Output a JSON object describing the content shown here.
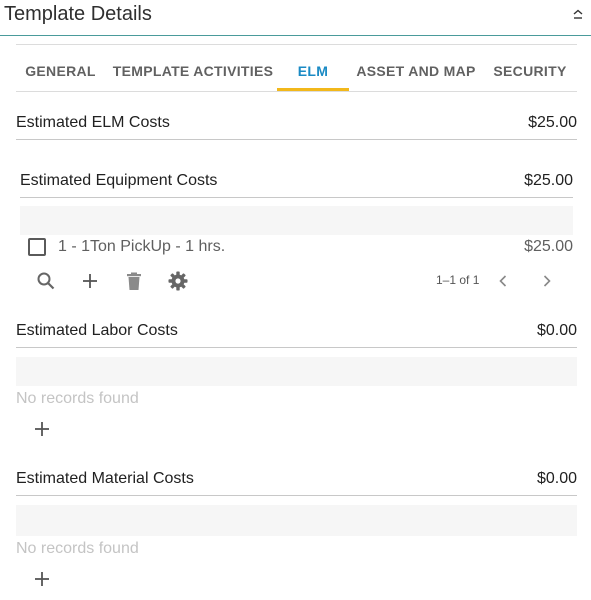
{
  "panel": {
    "title": "Template Details",
    "collapse_icon": "chevron-up-icon"
  },
  "tabs": [
    {
      "label": "GENERAL",
      "active": false
    },
    {
      "label": "TEMPLATE ACTIVITIES",
      "active": false
    },
    {
      "label": "ELM",
      "active": true
    },
    {
      "label": "ASSET AND MAP",
      "active": false
    },
    {
      "label": "SECURITY",
      "active": false
    }
  ],
  "colors": {
    "accent_tab_text": "#1a8ac4",
    "tab_indicator": "#f2b81b",
    "header_rule": "#4a9b9b"
  },
  "elm": {
    "title": "Estimated ELM Costs",
    "amount": "$25.00"
  },
  "equipment": {
    "title": "Estimated Equipment Costs",
    "amount": "$25.00",
    "rows": [
      {
        "label": "1 - 1Ton PickUp - 1 hrs.",
        "amount": "$25.00",
        "checked": false
      }
    ],
    "toolbar_icons": [
      "search-icon",
      "add-icon",
      "delete-icon",
      "settings-icon"
    ],
    "pager": {
      "text": "1–1 of 1",
      "prev_icon": "chevron-left-icon",
      "next_icon": "chevron-right-icon"
    }
  },
  "labor": {
    "title": "Estimated Labor Costs",
    "amount": "$0.00",
    "empty_text": "No records found"
  },
  "material": {
    "title": "Estimated Material Costs",
    "amount": "$0.00",
    "empty_text": "No records found"
  }
}
